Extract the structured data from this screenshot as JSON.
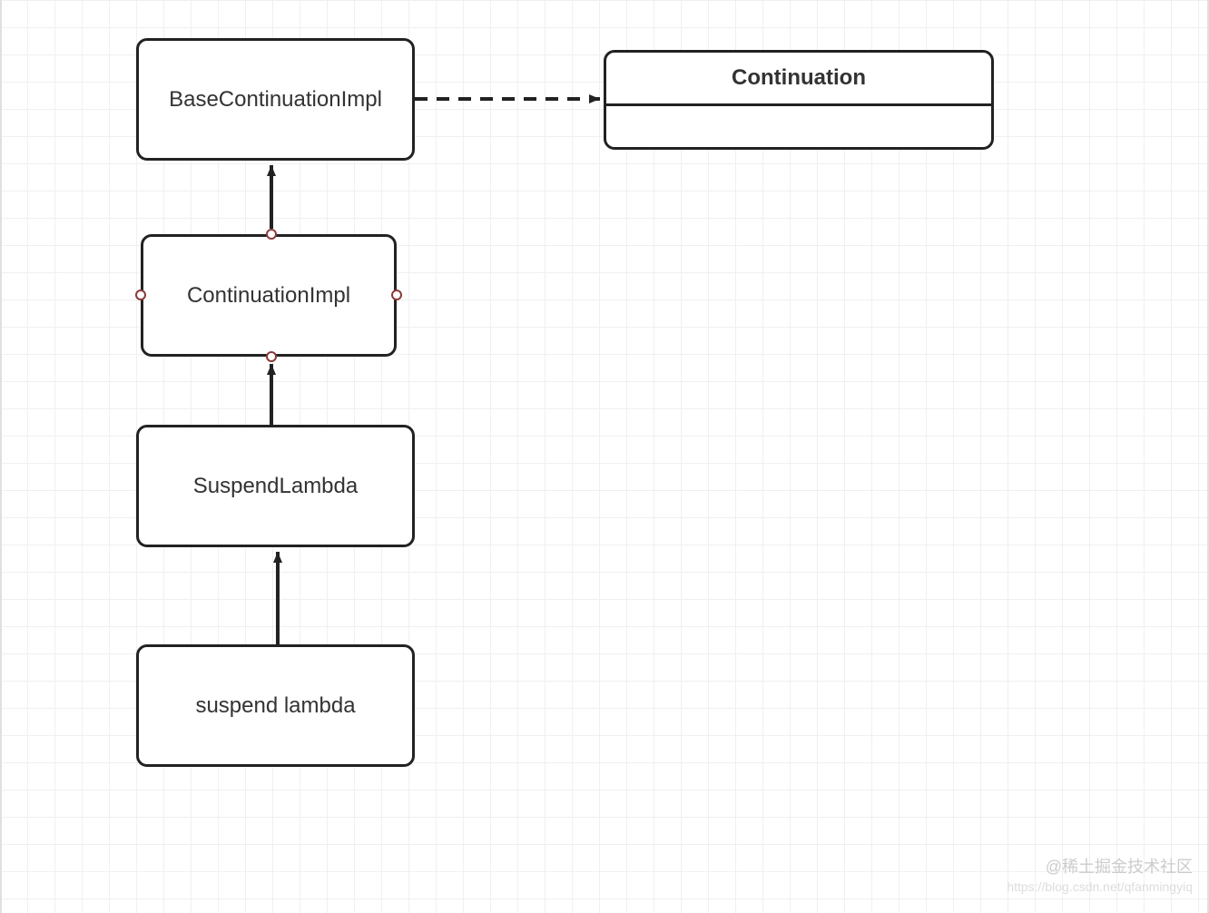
{
  "nodes": {
    "baseContinuationImpl": {
      "label": "BaseContinuationImpl"
    },
    "continuation": {
      "label": "Continuation"
    },
    "continuationImpl": {
      "label": "ContinuationImpl"
    },
    "suspendLambda": {
      "label": "SuspendLambda"
    },
    "suspendLambdaLower": {
      "label": "suspend lambda"
    }
  },
  "watermark": {
    "line1": "@稀土掘金技术社区",
    "line2": "https://blog.csdn.net/qfanmingyiq"
  }
}
